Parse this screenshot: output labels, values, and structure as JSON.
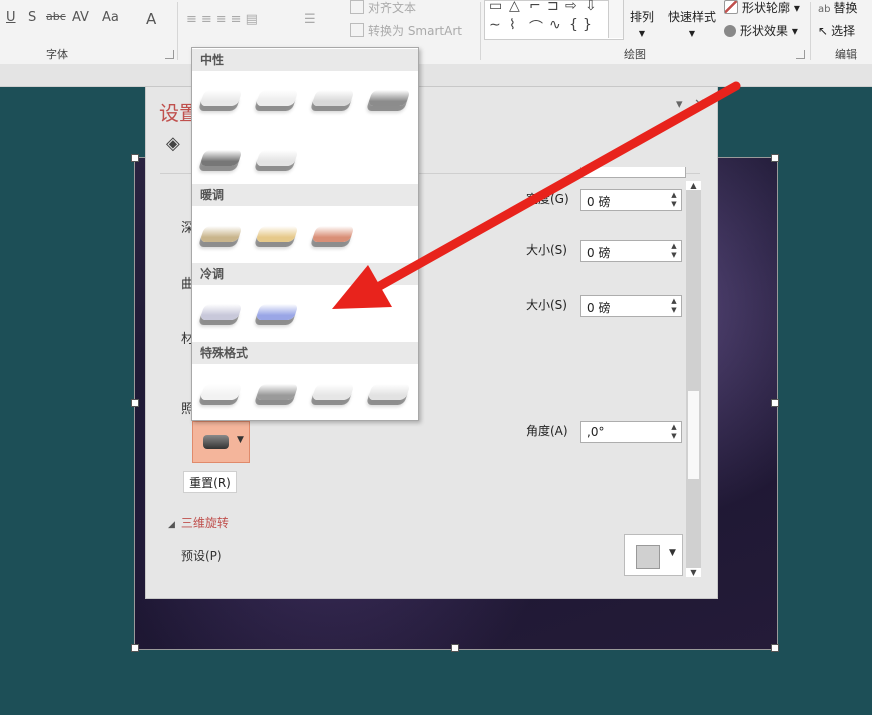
{
  "ribbon": {
    "font_group": "字体",
    "font_buttons": [
      "U",
      "S",
      "abc",
      "AV",
      "Aa",
      "A"
    ],
    "align_text": "对齐文本",
    "smartart": "转换为 SmartArt",
    "drawing_group": "绘图",
    "arrange": "排列",
    "quick_styles": "快速样式",
    "shape_outline": "形状轮廓",
    "shape_effects": "形状效果",
    "editing_group": "编辑",
    "replace": "替换",
    "select": "选择"
  },
  "pane": {
    "title": "设置",
    "labels_left": [
      "深",
      "曲",
      "材",
      "照"
    ],
    "depth_label": "宽度(G)",
    "depth_value": "0 磅",
    "size1_label": "大小(S)",
    "size1_value": "0 磅",
    "size2_label": "大小(S)",
    "size2_value": "0 磅",
    "angle_label": "角度(A)",
    "angle_value": ",0°",
    "reset_label": "重置(R)",
    "rotation_section": "三维旋转",
    "preset_label": "预设(P)"
  },
  "gallery": {
    "categories": [
      "中性",
      "暖调",
      "冷调",
      "特殊格式"
    ],
    "neutral": [
      "#e8e8e8",
      "#ececec",
      "#d8d8d8",
      "#8c8c8c",
      "#777777",
      "#e3e3e3"
    ],
    "warm": [
      "#c9b58c",
      "#e6c98a",
      "#d98f77"
    ],
    "cool": [
      "#c8c8da",
      "#9aa6e6"
    ],
    "special": [
      "#f2f2f2",
      "#9a9a9a",
      "#e6e6e6",
      "#e2e2e2"
    ]
  },
  "colors": {
    "accent": "#c0504d",
    "arrow": "#e8231c",
    "lighting_selected": "#f4b59b"
  }
}
